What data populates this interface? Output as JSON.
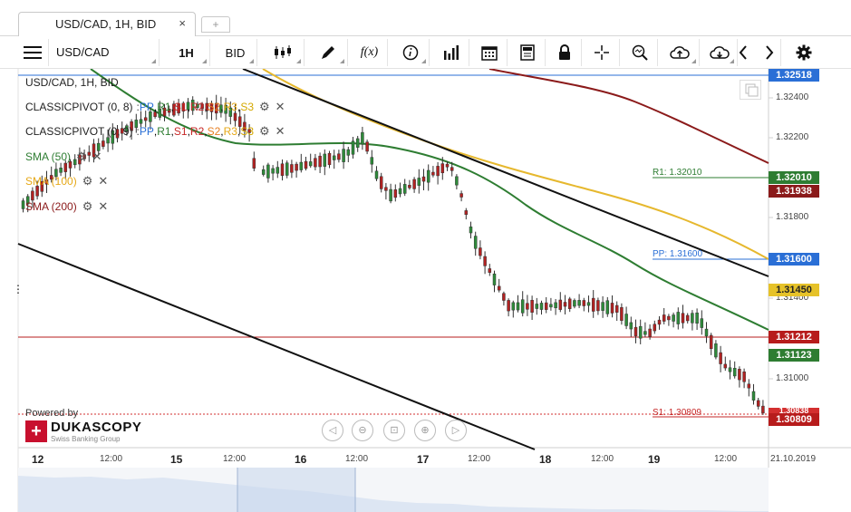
{
  "tab": {
    "title": "USD/CAD, 1H, BID",
    "close": "×",
    "add": "+"
  },
  "toolbar": {
    "symbol": "USD/CAD",
    "period": "1H",
    "side": "BID",
    "fx_label": "f(x)"
  },
  "chart": {
    "title": "USD/CAD, 1H, BID",
    "indicators": [
      {
        "name": "CLASSICPIVOT (0, 8)",
        "levels": [
          "PP",
          "R1",
          "S1",
          "R2",
          "S2",
          "R3",
          "S3"
        ]
      },
      {
        "name": "CLASSICPIVOT (0, 9)",
        "levels": [
          "PP",
          "R1",
          "S1",
          "R2",
          "S2",
          "R3",
          "S3"
        ]
      },
      {
        "name": "SMA (50)",
        "color": "#2e7d32"
      },
      {
        "name": "SMA (100)",
        "color": "#e6a817"
      },
      {
        "name": "SMA (200)",
        "color": "#8b1a1a"
      }
    ],
    "separators": {
      "dot": ":",
      "comma": ","
    },
    "y_axis": [
      "1.32400",
      "1.32200",
      "1.31800",
      "1.31400",
      "1.31000"
    ],
    "x_axis": [
      {
        "label": "12",
        "major": true
      },
      {
        "label": "12:00",
        "major": false
      },
      {
        "label": "15",
        "major": true
      },
      {
        "label": "12:00",
        "major": false
      },
      {
        "label": "16",
        "major": true
      },
      {
        "label": "12:00",
        "major": false
      },
      {
        "label": "17",
        "major": true
      },
      {
        "label": "12:00",
        "major": false
      },
      {
        "label": "18",
        "major": true
      },
      {
        "label": "12:00",
        "major": false
      },
      {
        "label": "19",
        "major": true
      },
      {
        "label": "12:00",
        "major": false
      },
      {
        "label": "21.10.2019",
        "major": false
      }
    ],
    "price_tags": [
      {
        "value": "1.32518",
        "color": "#2a6fd6"
      },
      {
        "value": "1.32010",
        "color": "#2e7d32"
      },
      {
        "value": "1.31938",
        "color": "#8b1a1a"
      },
      {
        "value": "1.31600",
        "color": "#2a6fd6"
      },
      {
        "value": "1.31450",
        "color": "#e6c229"
      },
      {
        "value": "1.31212",
        "color": "#b71c1c"
      },
      {
        "value": "1.31123",
        "color": "#2e7d32"
      },
      {
        "value": "1.30809",
        "color": "#b71c1c"
      },
      {
        "value": "1.30838",
        "color": "#d32f2f"
      }
    ],
    "line_labels": {
      "r1": "R1: 1.32010",
      "pp": "PP: 1.31600",
      "s1": "S1: 1.30809"
    },
    "powered_by": "Powered by",
    "brand": {
      "name": "DUKASCOPY",
      "sub": "Swiss Banking Group"
    }
  }
}
